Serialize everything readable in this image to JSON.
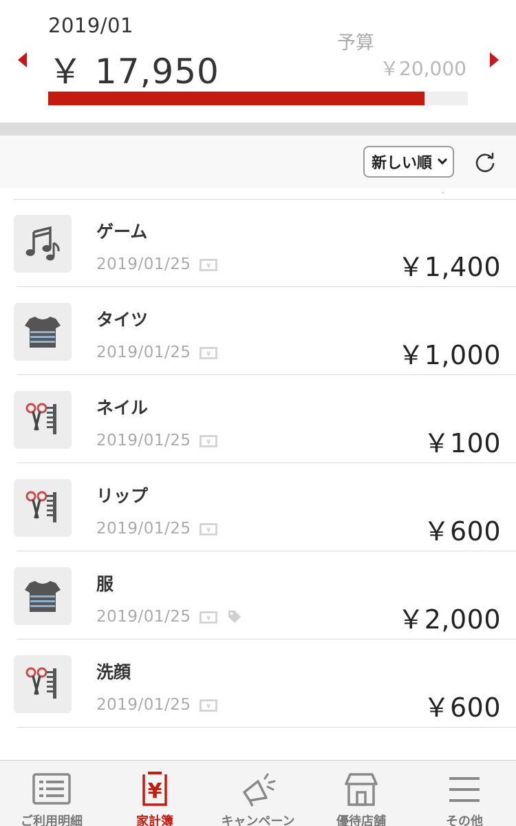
{
  "header": {
    "month": "2019/01",
    "spent": "￥ 17,950",
    "budget_label": "予算",
    "budget_value": "￥20,000",
    "progress_fraction": 0.8975,
    "accent_color": "#c41b10"
  },
  "toolbar": {
    "sort_label": "新しい順",
    "refresh_icon": "refresh-icon"
  },
  "items": [
    {
      "icon": "music-note-icon",
      "title": "ゲーム",
      "date": "2019/01/25",
      "amount": "￥1,400",
      "has_tag": false
    },
    {
      "icon": "shirt-icon",
      "title": "タイツ",
      "date": "2019/01/25",
      "amount": "￥1,000",
      "has_tag": false
    },
    {
      "icon": "scissors-comb-icon",
      "title": "ネイル",
      "date": "2019/01/25",
      "amount": "￥100",
      "has_tag": false
    },
    {
      "icon": "scissors-comb-icon",
      "title": "リップ",
      "date": "2019/01/25",
      "amount": "￥600",
      "has_tag": false
    },
    {
      "icon": "shirt-icon",
      "title": "服",
      "date": "2019/01/25",
      "amount": "￥2,000",
      "has_tag": true
    },
    {
      "icon": "scissors-comb-icon",
      "title": "洗顔",
      "date": "2019/01/25",
      "amount": "￥600",
      "has_tag": false
    }
  ],
  "nav": [
    {
      "label": "ご利用明細",
      "icon": "statement-list-icon",
      "active": false
    },
    {
      "label": "家計簿",
      "icon": "yen-register-icon",
      "active": true
    },
    {
      "label": "キャンペーン",
      "icon": "megaphone-icon",
      "active": false
    },
    {
      "label": "優待店舗",
      "icon": "shop-icon",
      "active": false
    },
    {
      "label": "その他",
      "icon": "hamburger-icon",
      "active": false
    }
  ]
}
